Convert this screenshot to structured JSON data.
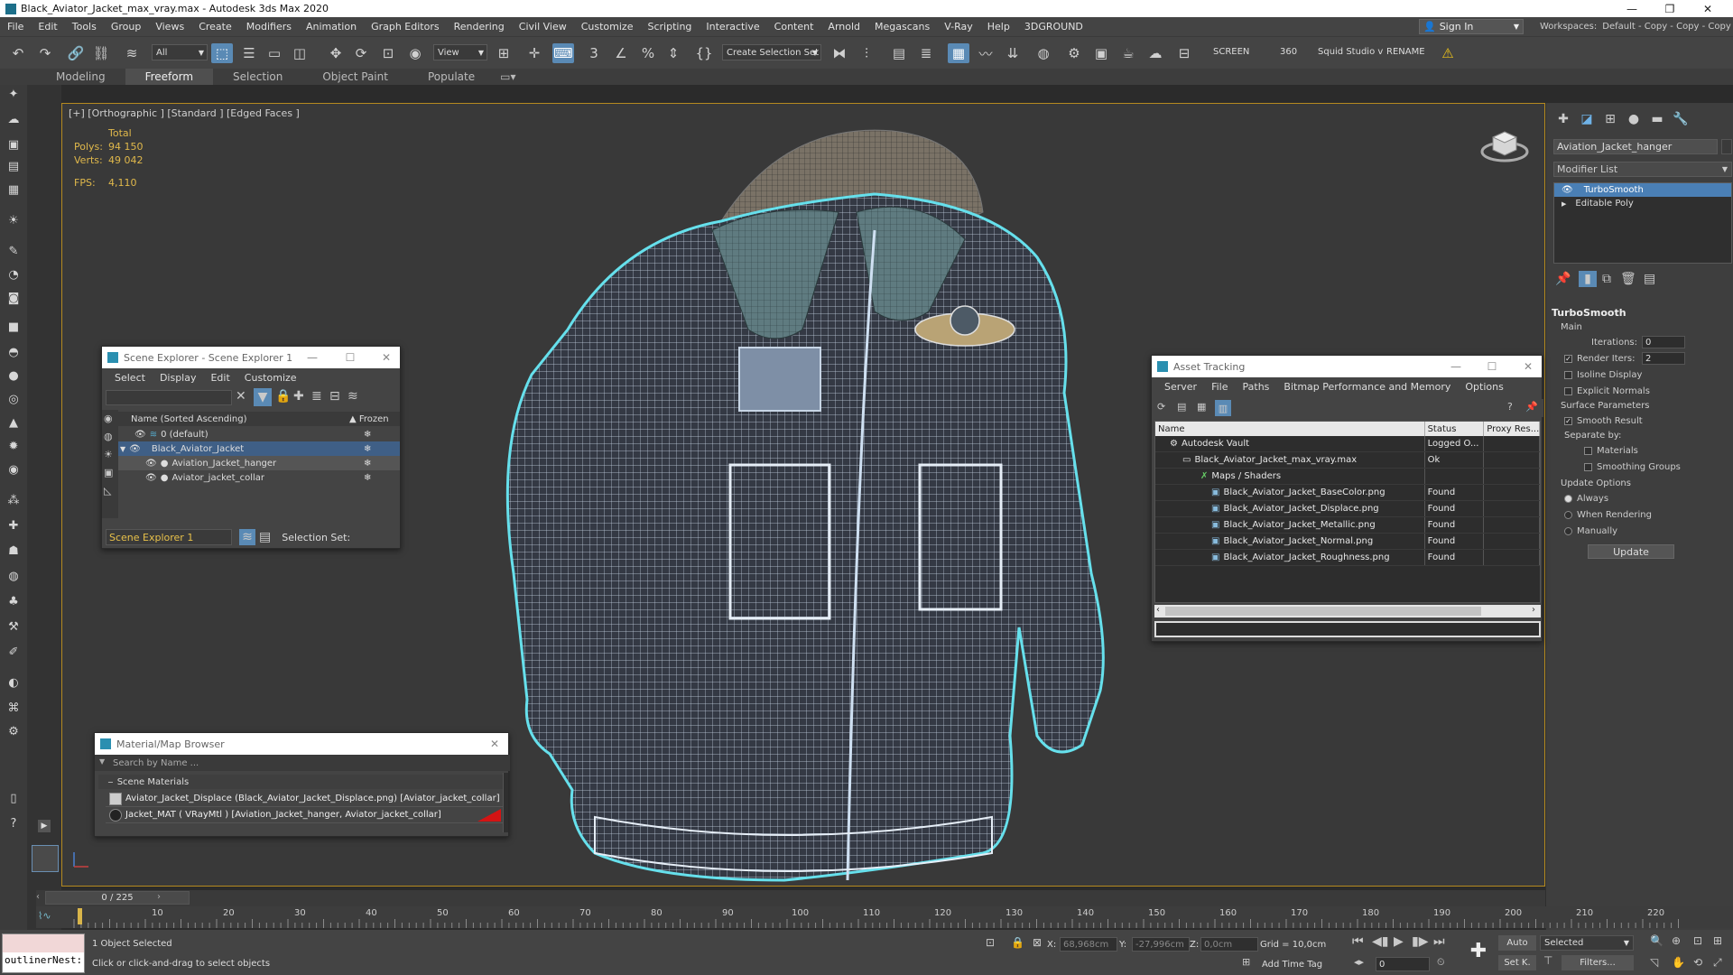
{
  "window": {
    "title": "Black_Aviator_Jacket_max_vray.max - Autodesk 3ds Max 2020"
  },
  "menu": [
    "File",
    "Edit",
    "Tools",
    "Group",
    "Views",
    "Create",
    "Modifiers",
    "Animation",
    "Graph Editors",
    "Rendering",
    "Civil View",
    "Customize",
    "Scripting",
    "Interactive",
    "Content",
    "Arnold",
    "Megascans",
    "V-Ray",
    "Help",
    "3DGROUND"
  ],
  "signin": {
    "label": "Sign In"
  },
  "workspaces": {
    "label": "Workspaces:",
    "value": "Default - Copy - Copy - Copy"
  },
  "toolbar": {
    "filter": "All",
    "refcoord": "View",
    "selset": "Create Selection Set",
    "screen": "SCREEN",
    "deg": "360",
    "squid": "Squid Studio v",
    "rename": "RENAME"
  },
  "ribbon": [
    "Modeling",
    "Freeform",
    "Selection",
    "Object Paint",
    "Populate"
  ],
  "viewport": {
    "label": "[+] [Orthographic ] [Standard ] [Edged Faces ]",
    "total": "Total",
    "polys_label": "Polys:",
    "polys": "94 150",
    "verts_label": "Verts:",
    "verts": "49 042",
    "fps_label": "FPS:",
    "fps": "4,110"
  },
  "scene_explorer": {
    "title": "Scene Explorer - Scene Explorer 1",
    "menu": [
      "Select",
      "Display",
      "Edit",
      "Customize"
    ],
    "col_name": "Name (Sorted Ascending)",
    "col_frozen": "▲ Frozen",
    "rows": [
      "0 (default)",
      "Black_Aviator_Jacket",
      "Aviation_Jacket_hanger",
      "Aviator_jacket_collar"
    ],
    "footer_name": "Scene Explorer 1",
    "footer_sel": "Selection Set:"
  },
  "asset_tracking": {
    "title": "Asset Tracking",
    "menu": [
      "Server",
      "File",
      "Paths",
      "Bitmap Performance and Memory",
      "Options"
    ],
    "cols": [
      "Name",
      "Status",
      "Proxy Res..."
    ],
    "rows": [
      {
        "name": "Autodesk Vault",
        "status": "Logged O..."
      },
      {
        "name": "Black_Aviator_Jacket_max_vray.max",
        "status": "Ok"
      },
      {
        "name": "Maps / Shaders",
        "status": ""
      },
      {
        "name": "Black_Aviator_Jacket_BaseColor.png",
        "status": "Found"
      },
      {
        "name": "Black_Aviator_Jacket_Displace.png",
        "status": "Found"
      },
      {
        "name": "Black_Aviator_Jacket_Metallic.png",
        "status": "Found"
      },
      {
        "name": "Black_Aviator_Jacket_Normal.png",
        "status": "Found"
      },
      {
        "name": "Black_Aviator_Jacket_Roughness.png",
        "status": "Found"
      }
    ]
  },
  "mat_browser": {
    "title": "Material/Map Browser",
    "search": "Search by Name ...",
    "group": "Scene Materials",
    "rows": [
      "Aviator_Jacket_Displace (Black_Aviator_Jacket_Displace.png) [Aviator_jacket_collar]",
      "Jacket_MAT  ( VRayMtl ) [Aviation_Jacket_hanger, Aviator_jacket_collar]"
    ]
  },
  "cmdpanel": {
    "object_name": "Aviation_Jacket_hanger",
    "modifier_list": "Modifier List",
    "stack": [
      "TurboSmooth",
      "Editable Poly"
    ],
    "rollout": "TurboSmooth",
    "main": "Main",
    "iterations_label": "Iterations:",
    "iterations": "0",
    "render_iters_label": "Render Iters:",
    "render_iters": "2",
    "isoline": "Isoline Display",
    "explicit": "Explicit Normals",
    "surface": "Surface Parameters",
    "smooth": "Smooth Result",
    "separate": "Separate by:",
    "materials": "Materials",
    "smoothing": "Smoothing Groups",
    "update_opts": "Update Options",
    "always": "Always",
    "when_render": "When Rendering",
    "manually": "Manually",
    "update_btn": "Update"
  },
  "timeline": {
    "frame": "0 / 225",
    "ticks": [
      "10",
      "20",
      "30",
      "40",
      "50",
      "60",
      "70",
      "80",
      "90",
      "100",
      "110",
      "120",
      "130",
      "140",
      "150",
      "160",
      "170",
      "180",
      "190",
      "200",
      "210",
      "220"
    ]
  },
  "status": {
    "maxscript": "outlinerNest:",
    "selected": "1 Object Selected",
    "hint": "Click or click-and-drag to select objects",
    "x_label": "X:",
    "x": "68,968cm",
    "y_label": "Y:",
    "y": "-27,996cm",
    "z_label": "Z:",
    "z": "0,0cm",
    "grid": "Grid = 10,0cm",
    "add_time_tag": "Add Time Tag",
    "auto": "Auto",
    "selected_dd": "Selected",
    "setk": "Set K.",
    "filters": "Filters...",
    "frame_field": "0"
  }
}
